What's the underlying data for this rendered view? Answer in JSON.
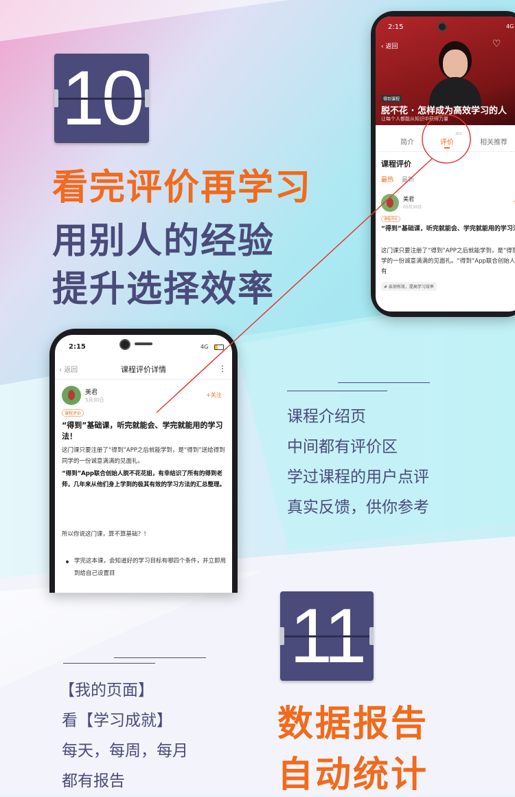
{
  "section10": {
    "number": "10",
    "headline_1": "看完评价再学习",
    "headline_2": "用别人的经验",
    "headline_3": "提升选择效率"
  },
  "phone_top": {
    "time": "2:15",
    "signal": "4G",
    "back": "返回",
    "course_tag": "得到课程",
    "course_title": "脱不花 · 怎样成为高效学习的人",
    "course_subtitle": "让每个人都能从知识中获得力量",
    "tabs": [
      "简介",
      "评价",
      "相关推荐"
    ],
    "tab_count": "301",
    "section_title": "课程评价",
    "filters": [
      "最热",
      "最新"
    ],
    "reviewer": "美君",
    "date": "05月30日",
    "follow": "+",
    "badge": "课程评价",
    "review_title": "“得到”基础课，听完就能会、学完就能用的学习法！",
    "review_body": "这门课只要注册了“得到”APP之后就能学到，是“得到”送给得到同学的一份诚意满满的见面礼。“得到”App联合创始人脱不花花姐，有",
    "hashtag": "# 亲测有效，提高学习效率"
  },
  "phone_bottom": {
    "time": "2:15",
    "signal": "4G",
    "back": "返回",
    "title": "课程评价详情",
    "more": "⋮",
    "reviewer": "美君",
    "date": "5月30日",
    "follow": "+关注",
    "badge": "课程评价",
    "review_title": "“得到”基础课，听完就能会、学完就能用的学习法！",
    "para1": "这门课只要注册了“得到”APP之后就能学到，是“得到”送给得到同学的一份诚意满满的见面礼。",
    "para2": "“得到”App联合创始人脱不花花姐，有幸结识了所有的得到老师，几年来从他们身上学到的极其有效的学习方法的汇总整理。",
    "para3": "所以你说这门课，算不算基础？！",
    "bullet": "学完这本课，会知道好的学习目标有哪四个条件，并立即用到给自己设置目"
  },
  "middle_text": {
    "line1": "课程介绍页",
    "line2": "中间都有评价区",
    "line3": "学过课程的用户点评",
    "line4": "真实反馈，供你参考"
  },
  "section11": {
    "number": "11",
    "headline_1": "数据报告",
    "headline_2": "自动统计"
  },
  "left_bottom_text": {
    "line1": "【我的页面】",
    "line2": "看【学习成就】",
    "line3": "每天，每周，每月",
    "line4": "都有报告"
  },
  "colors": {
    "orange": "#f26a1b",
    "navy": "#4a4b7a",
    "accent_red": "#e53935"
  }
}
